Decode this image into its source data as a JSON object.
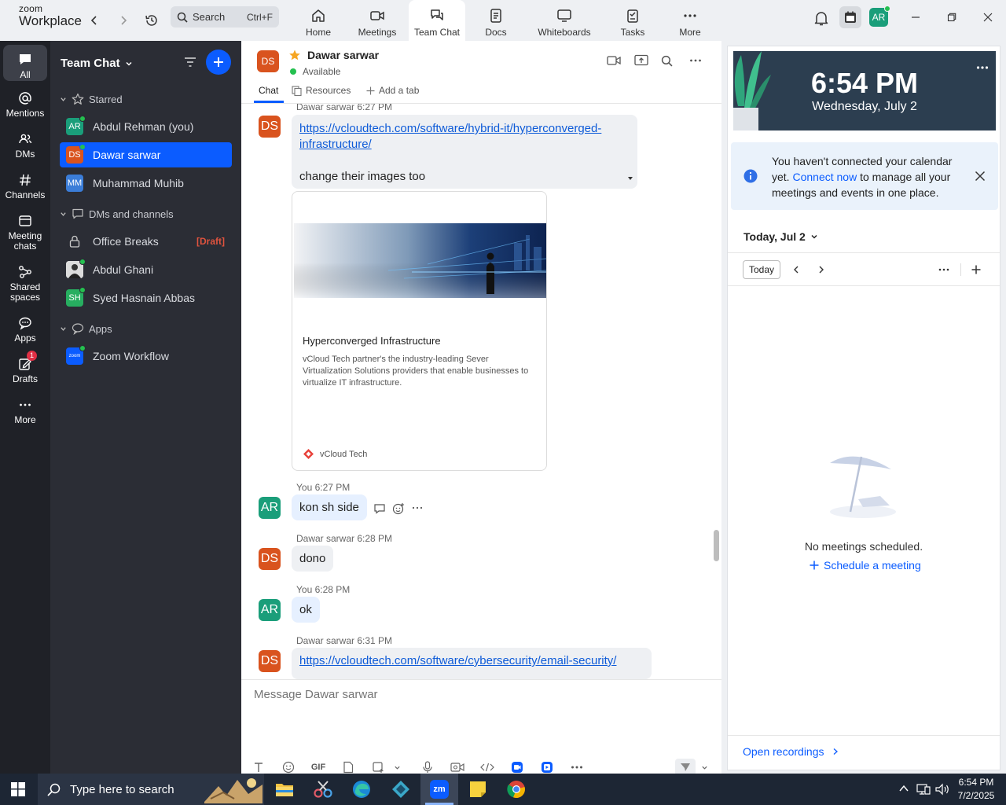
{
  "app": {
    "logo_top": "zoom",
    "logo_bottom": "Workplace"
  },
  "search": {
    "label": "Search",
    "shortcut": "Ctrl+F"
  },
  "top_tabs": [
    {
      "label": "Home",
      "icon": "home-icon"
    },
    {
      "label": "Meetings",
      "icon": "meetings-icon"
    },
    {
      "label": "Team Chat",
      "icon": "team-chat-icon",
      "active": true
    },
    {
      "label": "Docs",
      "icon": "docs-icon"
    },
    {
      "label": "Whiteboards",
      "icon": "whiteboards-icon"
    },
    {
      "label": "Tasks",
      "icon": "tasks-icon"
    },
    {
      "label": "More",
      "icon": "more-icon"
    }
  ],
  "user_avatar": {
    "initials": "AR",
    "color": "#1a9e7a"
  },
  "rail": [
    {
      "label": "All",
      "icon": "chat-icon",
      "active": true
    },
    {
      "label": "Mentions",
      "icon": "mention-icon"
    },
    {
      "label": "DMs",
      "icon": "dms-icon"
    },
    {
      "label": "Channels",
      "icon": "channels-icon"
    },
    {
      "label": "Meeting chats",
      "icon": "meeting-chats-icon"
    },
    {
      "label": "Shared spaces",
      "icon": "shared-spaces-icon"
    },
    {
      "label": "Apps",
      "icon": "apps-icon"
    },
    {
      "label": "Drafts",
      "icon": "drafts-icon",
      "badge": "1"
    },
    {
      "label": "More",
      "icon": "more-icon"
    }
  ],
  "sidebar": {
    "title": "Team Chat",
    "starred_label": "Starred",
    "starred": [
      {
        "initials": "AR",
        "name": "Abdul Rehman (you)",
        "color": "#1a9e7a",
        "online": true
      },
      {
        "initials": "DS",
        "name": "Dawar sarwar",
        "color": "#d9531e",
        "online": true,
        "selected": true
      },
      {
        "initials": "MM",
        "name": "Muhammad Muhib",
        "color": "#3b7dd8",
        "online": false
      }
    ],
    "dms_label": "DMs and channels",
    "dms": [
      {
        "name": "Office Breaks",
        "draft": "[Draft]",
        "icon": "lock-icon"
      },
      {
        "name": "Abdul Ghani",
        "photo": true,
        "online": true
      },
      {
        "initials": "SH",
        "name": "Syed Hasnain Abbas",
        "color": "#27ae60",
        "online": true
      }
    ],
    "apps_label": "Apps",
    "apps": [
      {
        "name": "Zoom Workflow",
        "logo": "zoom"
      }
    ]
  },
  "chat": {
    "contact": {
      "initials": "DS",
      "name": "Dawar sarwar",
      "status": "Available",
      "color": "#d9531e"
    },
    "tabs": [
      "Chat",
      "Resources",
      "Add a tab"
    ],
    "messages": [
      {
        "sender": "Dawar sarwar",
        "time": "6:27 PM",
        "initials": "DS",
        "link": "https://vcloudtech.com/software/hybrid-it/hyperconverged-infrastructure/",
        "link_line1": "https://vcloudtech.com/software/hybrid-it/hyperconverged-",
        "link_line2": "infrastructure/",
        "text": "change their images too"
      },
      {
        "card_title": "Hyperconverged Infrastructure",
        "card_desc": "vCloud Tech partner's the industry-leading Sever Virtualization Solutions providers that enable businesses to virtualize IT infrastructure.",
        "card_source": "vCloud Tech"
      },
      {
        "sender": "You",
        "time": "6:27 PM",
        "initials": "AR",
        "text": "kon sh side"
      },
      {
        "sender": "Dawar sarwar",
        "time": "6:28 PM",
        "initials": "DS",
        "text": "dono"
      },
      {
        "sender": "You",
        "time": "6:28 PM",
        "initials": "AR",
        "text": "ok"
      },
      {
        "sender": "Dawar sarwar",
        "time": "6:31 PM",
        "initials": "DS",
        "link": "https://vcloudtech.com/software/cybersecurity/email-security/"
      }
    ],
    "composer_placeholder": "Message Dawar sarwar",
    "gif_label": "GIF"
  },
  "right": {
    "time": "6:54 PM",
    "date": "Wednesday, July 2",
    "notice_pre": "You haven't connected your calendar yet.",
    "notice_link": "Connect now",
    "notice_post": "to manage all your meetings and events in one place.",
    "day_label": "Today, Jul 2",
    "today_btn": "Today",
    "empty": "No meetings scheduled.",
    "schedule": "Schedule a meeting",
    "recordings": "Open recordings"
  },
  "taskbar": {
    "search": "Type here to search",
    "time": "6:54 PM",
    "date": "7/2/2025"
  },
  "colors": {
    "accent": "#0b5cff",
    "sidebar": "#2b2d35",
    "rail": "#1f2127",
    "ds": "#d9531e",
    "ar": "#1a9e7a"
  }
}
